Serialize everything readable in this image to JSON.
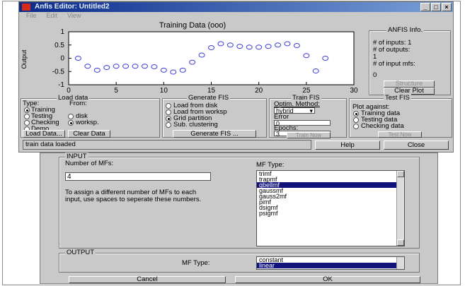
{
  "window": {
    "title": "Anfis Editor: Untitled2",
    "menu": [
      "File",
      "Edit",
      "View"
    ],
    "controls": [
      "_",
      "□",
      "×"
    ]
  },
  "plot": {
    "title": "Training Data (ooo)",
    "ylabel": "Output",
    "yticks": [
      "1",
      "0.5",
      "0",
      "-0.5",
      "-1"
    ],
    "xticks": [
      "0",
      "5",
      "10",
      "15",
      "20",
      "25",
      "30"
    ]
  },
  "chart_data": {
    "type": "scatter",
    "title": "Training Data (ooo)",
    "xlabel": "",
    "ylabel": "Output",
    "xlim": [
      0,
      30
    ],
    "ylim": [
      -1,
      1
    ],
    "x": [
      1,
      2,
      3,
      4,
      5,
      6,
      7,
      8,
      9,
      10,
      11,
      12,
      13,
      14,
      15,
      16,
      17,
      18,
      19,
      20,
      21,
      22,
      23,
      24,
      25,
      26,
      27
    ],
    "y": [
      0,
      -0.3,
      -0.45,
      -0.35,
      -0.3,
      -0.3,
      -0.3,
      -0.3,
      -0.32,
      -0.45,
      -0.52,
      -0.45,
      -0.15,
      0.12,
      0.4,
      0.55,
      0.5,
      0.45,
      0.42,
      0.42,
      0.45,
      0.5,
      0.55,
      0.48,
      0.1,
      -0.48,
      0
    ],
    "marker": "circle",
    "color": "#3a3ad6"
  },
  "anfis_info": {
    "title": "ANFIS Info.",
    "lines": [
      "# of inputs: 1",
      "# of outputs:",
      "1",
      "# of input mfs:",
      "",
      "0"
    ],
    "structure_button": "Structure",
    "clear_plot_button": "Clear Plot"
  },
  "load_data": {
    "title": "Load data",
    "type_label": "Type:",
    "from_label": "From:",
    "type_options": [
      "Training",
      "Testing",
      "Checking",
      "Demo"
    ],
    "from_options": [
      "disk",
      "worksp."
    ],
    "load_button": "Load Data...",
    "clear_button": "Clear Data"
  },
  "generate_fis": {
    "title": "Generate FIS",
    "options": [
      "Load from disk",
      "Load from worksp",
      "Grid partition",
      "Sub. clustering"
    ],
    "button": "Generate FIS ..."
  },
  "train_fis": {
    "title": "Train FIS",
    "method_label": "Optim. Method:",
    "method_value": "hybrid",
    "error_label": "Error",
    "error_value": "0",
    "epochs_label": "Epochs:",
    "epochs_value": "3",
    "button": "Train Now"
  },
  "test_fis": {
    "title": "Test FIS",
    "plot_against": "Plot against:",
    "options": [
      "Training data",
      "Testing data",
      "Checking data"
    ],
    "button": "Test Now"
  },
  "status": "train data loaded",
  "help_button": "Help",
  "close_button": "Close",
  "input_section": {
    "title": "INPUT",
    "num_mfs_label": "Number of MFs:",
    "num_mfs_value": "4",
    "hint": "To assign a different number of MFs to each input, use spaces to seperate these numbers.",
    "mf_type_label": "MF Type:",
    "mf_types": [
      "trimf",
      "trapmf",
      "gbellmf",
      "gaussmf",
      "gauss2mf",
      "pimf",
      "dsigmf",
      "psigmf"
    ],
    "selected_mf_type": "gbellmf"
  },
  "output_section": {
    "title": "OUTPUT",
    "mf_type_label": "MF Type:",
    "mf_types": [
      "constant",
      "linear"
    ],
    "selected_mf_type": "linear"
  },
  "cancel_button": "Cancel",
  "ok_button": "OK"
}
